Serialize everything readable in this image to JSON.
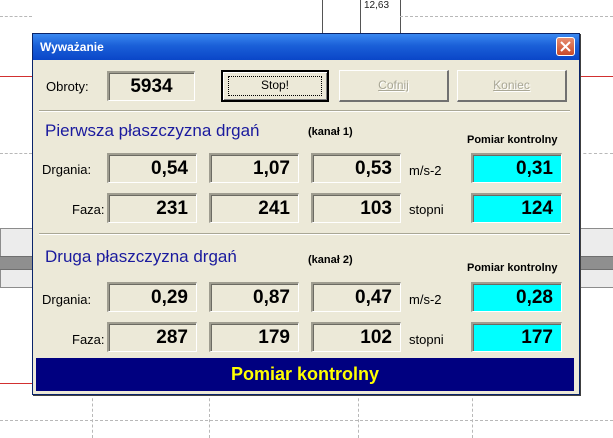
{
  "background": {
    "top_value": "12,63"
  },
  "dialog": {
    "title": "Wyważanie",
    "rpm_label": "Obroty:",
    "rpm_value": "5934",
    "buttons": {
      "stop": "Stop!",
      "undo": "Cofnij",
      "end": "Koniec"
    },
    "plane1": {
      "title": "Pierwsza płaszczyzna drgań",
      "channel": "(kanał 1)",
      "control_header": "Pomiar kontrolny",
      "vibration_label": "Drgania:",
      "vibration": [
        "0,54",
        "1,07",
        "0,53"
      ],
      "vibration_unit": "m/s-2",
      "vibration_control": "0,31",
      "phase_label": "Faza:",
      "phase": [
        "231",
        "241",
        "103"
      ],
      "phase_unit": "stopni",
      "phase_control": "124"
    },
    "plane2": {
      "title": "Druga płaszczyzna drgań",
      "channel": "(kanał 2)",
      "control_header": "Pomiar kontrolny",
      "vibration_label": "Drgania:",
      "vibration": [
        "0,29",
        "0,87",
        "0,47"
      ],
      "vibration_unit": "m/s-2",
      "vibration_control": "0,28",
      "phase_label": "Faza:",
      "phase": [
        "287",
        "179",
        "102"
      ],
      "phase_unit": "stopni",
      "phase_control": "177"
    },
    "status": "Pomiar kontrolny"
  },
  "colors": {
    "title_bar": "#0a46c8",
    "section_title": "#1a1a9e",
    "control_box": "#00FFFF",
    "status_bg": "#000080",
    "status_text": "#ffff00"
  }
}
